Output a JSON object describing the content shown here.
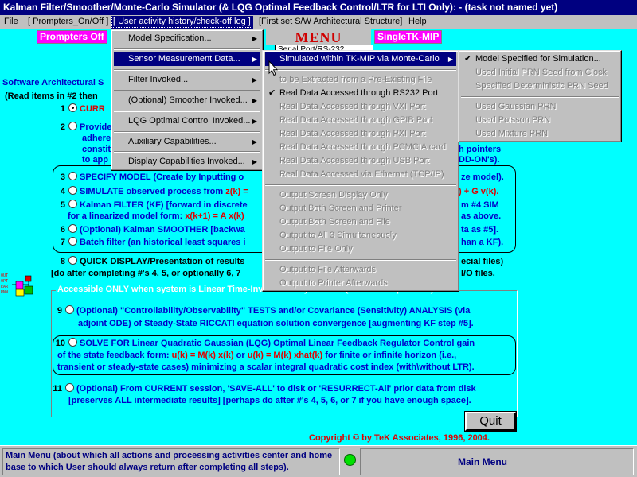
{
  "window": {
    "title": "Kalman Filter/Smoother/Monte-Carlo Simulator (& LQG Optimal Feedback Control/LTR for LTI Only): - (task not named yet)"
  },
  "menubar": {
    "file": "File",
    "prompters": "[ Prompters_On/Off ]",
    "history": "[ User activity history/check-off log ]",
    "first_set": "[First set S/W Architectural Structure]",
    "help": "Help"
  },
  "header": {
    "prompters_off": "Prompters Off",
    "menu_title": "MENU",
    "single_tk": "SingleTK-MIP",
    "serial_tab": "Serial Port/RS-232"
  },
  "background": {
    "sw_arch": "Software Architectural S",
    "read_items": "(Read items in #2 then",
    "item1_label": "CURR",
    "item2_line1": "Provide",
    "item2_line2": "adhere",
    "item2_line3": "constit",
    "item2_line4": "to app",
    "item2_right1": "h pointers",
    "item2_right2": "DD-ON's).",
    "item3": "SPECIFY MODEL  (Create by Inputting o",
    "item3_right": "ze model).",
    "item4": "SIMULATE observed process from",
    "item4_red": "z(k) =",
    "item4_right": ") + G v(k).",
    "item5_line1": "Kalman FILTER (KF) [forward in discrete",
    "item5_right1": "m #4 SIM",
    "item5_line2": "for a linearized model form:",
    "item5_red": "x(k+1) = A x(k)",
    "item5_right2": "as above.",
    "item6": "(Optional) Kalman SMOOTHER  [backwa",
    "item6_right": "ta as #5].",
    "item7": "Batch filter (an historical least squares i",
    "item7_right": "han a KF).",
    "item8": "QUICK DISPLAY/Presentation of results",
    "item8_right": "ecial files)",
    "item8_line2": "[do after completing #'s 4, 5, or optionally 6, 7",
    "item8_right2": "I/O files.",
    "frame_label": "Accessible ONLY when system is Linear Time-Invariant & Symmetric (Discrete or periodic)",
    "item9_line1": "(Optional) \"Controllability/Observability\" TESTS and/or Covariance (Sensitivity) ANALYSIS (via",
    "item9_line2": "adjoint ODE) of Steady-State RICCATI equation solution convergence [augmenting KF step #5].",
    "item10_line1": "SOLVE FOR Linear Quadratic Gaussian (LQG) Optimal Linear Feedback Regulator Control gain",
    "item10_line2a": "of the state feedback form:",
    "item10_red": "u(k) = M(k) x(k)",
    "item10_or": "or",
    "item10_red2": "u(k) = M(k) xhat(k)",
    "item10_line2b": "for finite or infinite horizon (i.e.,",
    "item10_line3": "transient or steady-state cases) minimizing a scalar integral quadratic cost index (with\\without LTR).",
    "item11_line1": "(Optional) From CURRENT session, 'SAVE-ALL' to disk or 'RESURRECT-All' prior data from disk",
    "item11_line2": "[preserves ALL intermediate results] [perhaps do after #'s 4, 5, 6, or 7 if you have enough space].",
    "nums": [
      "1",
      "2",
      "3",
      "4",
      "5",
      "6",
      "7",
      "8",
      "9",
      "10",
      "11"
    ]
  },
  "quit_label": "Quit",
  "copyright": "Copyright © by TeK Associates, 1996, 2004.",
  "status": {
    "left": "Main Menu (about which all actions and processing activities center and home base to which User should always return after completing all steps).",
    "right": "Main Menu"
  },
  "menu1": [
    {
      "label": "Model Specification...",
      "arrow": true
    },
    {
      "label": "Sensor Measurement Data...",
      "arrow": true,
      "highlight": true
    },
    {
      "label": "Filter Invoked...",
      "arrow": true
    },
    {
      "label": "(Optional) Smoother Invoked...",
      "arrow": true
    },
    {
      "label": "LQG Optimal Control Invoked...",
      "arrow": true
    },
    {
      "label": "Auxiliary Capabilities...",
      "arrow": true
    },
    {
      "label": "Display Capabilities Invoked...",
      "arrow": true
    }
  ],
  "menu2": [
    {
      "label": "Simulated within TK-MIP via Monte-Carlo",
      "arrow": true,
      "highlight": true
    },
    {
      "label": "to be Extracted from a Pre-Existing File",
      "disabled": true
    },
    {
      "label": "Real Data Accessed through RS232 Port",
      "checked": true
    },
    {
      "label": "Real Data Accessed through VXI Port",
      "disabled": true
    },
    {
      "label": "Real Data Accessed through GPIB Port",
      "disabled": true
    },
    {
      "label": "Real Data Accessed through PXI Port",
      "disabled": true
    },
    {
      "label": "Real Data Accessed through PCMCIA card",
      "disabled": true
    },
    {
      "label": "Real Data Accessed through USB Port",
      "disabled": true
    },
    {
      "label": "Real Data Accessed via Ethernet (TCP/IP)",
      "disabled": true
    },
    {
      "label": "Output Screen Display Only",
      "disabled": true
    },
    {
      "label": "Output Both Screen and Printer",
      "disabled": true
    },
    {
      "label": "Output Both Screen and File",
      "disabled": true
    },
    {
      "label": "Output to All 3 Simultaneously",
      "disabled": true
    },
    {
      "label": "Output to File Only",
      "disabled": true
    },
    {
      "label": "Output to File Afterwards",
      "disabled": true
    },
    {
      "label": "Output to Printer Afterwards",
      "disabled": true
    }
  ],
  "menu3": [
    {
      "label": "Model Specified for Simulation...",
      "checked": true
    },
    {
      "label": "Used Initial PRN Seed from Clock",
      "disabled": true
    },
    {
      "label": "Specified Deterministic PRN Seed",
      "disabled": true
    },
    {
      "label": "Used Gaussian PRN",
      "disabled": true
    },
    {
      "label": "Used Poisson PRN",
      "disabled": true
    },
    {
      "label": "Used Mixture PRN",
      "disabled": true
    }
  ]
}
